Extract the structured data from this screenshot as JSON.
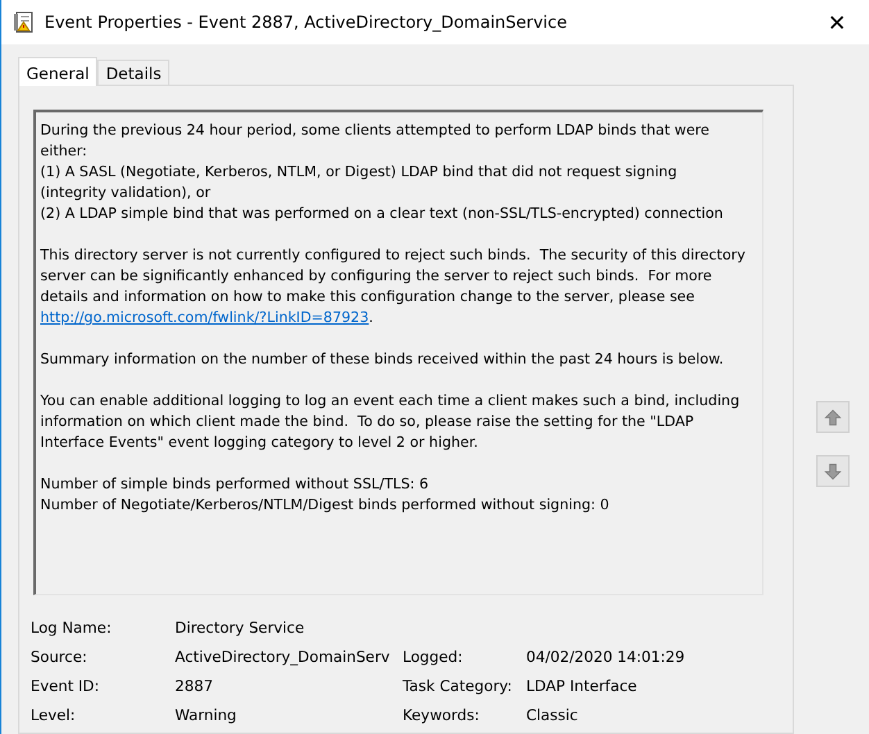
{
  "window": {
    "title": "Event Properties - Event 2887, ActiveDirectory_DomainService",
    "close": "✕"
  },
  "tabs": [
    {
      "label": "General",
      "selected": true
    },
    {
      "label": "Details",
      "selected": false
    }
  ],
  "description": [
    {
      "text": "During the previous 24 hour period, some clients attempted to perform LDAP binds that were\neither:\n(1) A SASL (Negotiate, Kerberos, NTLM, or Digest) LDAP bind that did not request signing\n(integrity validation), or\n(2) A LDAP simple bind that was performed on a clear text (non-SSL/TLS-encrypted) connection"
    },
    {
      "text": "This directory server is not currently configured to reject such binds.  The security of this directory\nserver can be significantly enhanced by configuring the server to reject such binds.  For more\ndetails and information on how to make this configuration change to the server, please see\n",
      "link": "http://go.microsoft.com/fwlink/?LinkID=87923",
      "after": "."
    },
    {
      "text": "Summary information on the number of these binds received within the past 24 hours is below."
    },
    {
      "text": "You can enable additional logging to log an event each time a client makes such a bind, including\ninformation on which client made the bind.  To do so, please raise the setting for the \"LDAP\nInterface Events\" event logging category to level 2 or higher."
    },
    {
      "text": "Number of simple binds performed without SSL/TLS: 6\nNumber of Negotiate/Kerberos/NTLM/Digest binds performed without signing: 0"
    }
  ],
  "fields": [
    [
      {
        "label": "Log Name:",
        "value": "Directory Service"
      }
    ],
    [
      {
        "label": "Source:",
        "value": "ActiveDirectory_DomainServ"
      },
      {
        "label": "Logged:",
        "value": "04/02/2020 14:01:29"
      }
    ],
    [
      {
        "label": "Event ID:",
        "value": "2887"
      },
      {
        "label": "Task Category:",
        "value": "LDAP Interface"
      }
    ],
    [
      {
        "label": "Level:",
        "value": "Warning"
      },
      {
        "label": "Keywords:",
        "value": "Classic"
      }
    ]
  ]
}
